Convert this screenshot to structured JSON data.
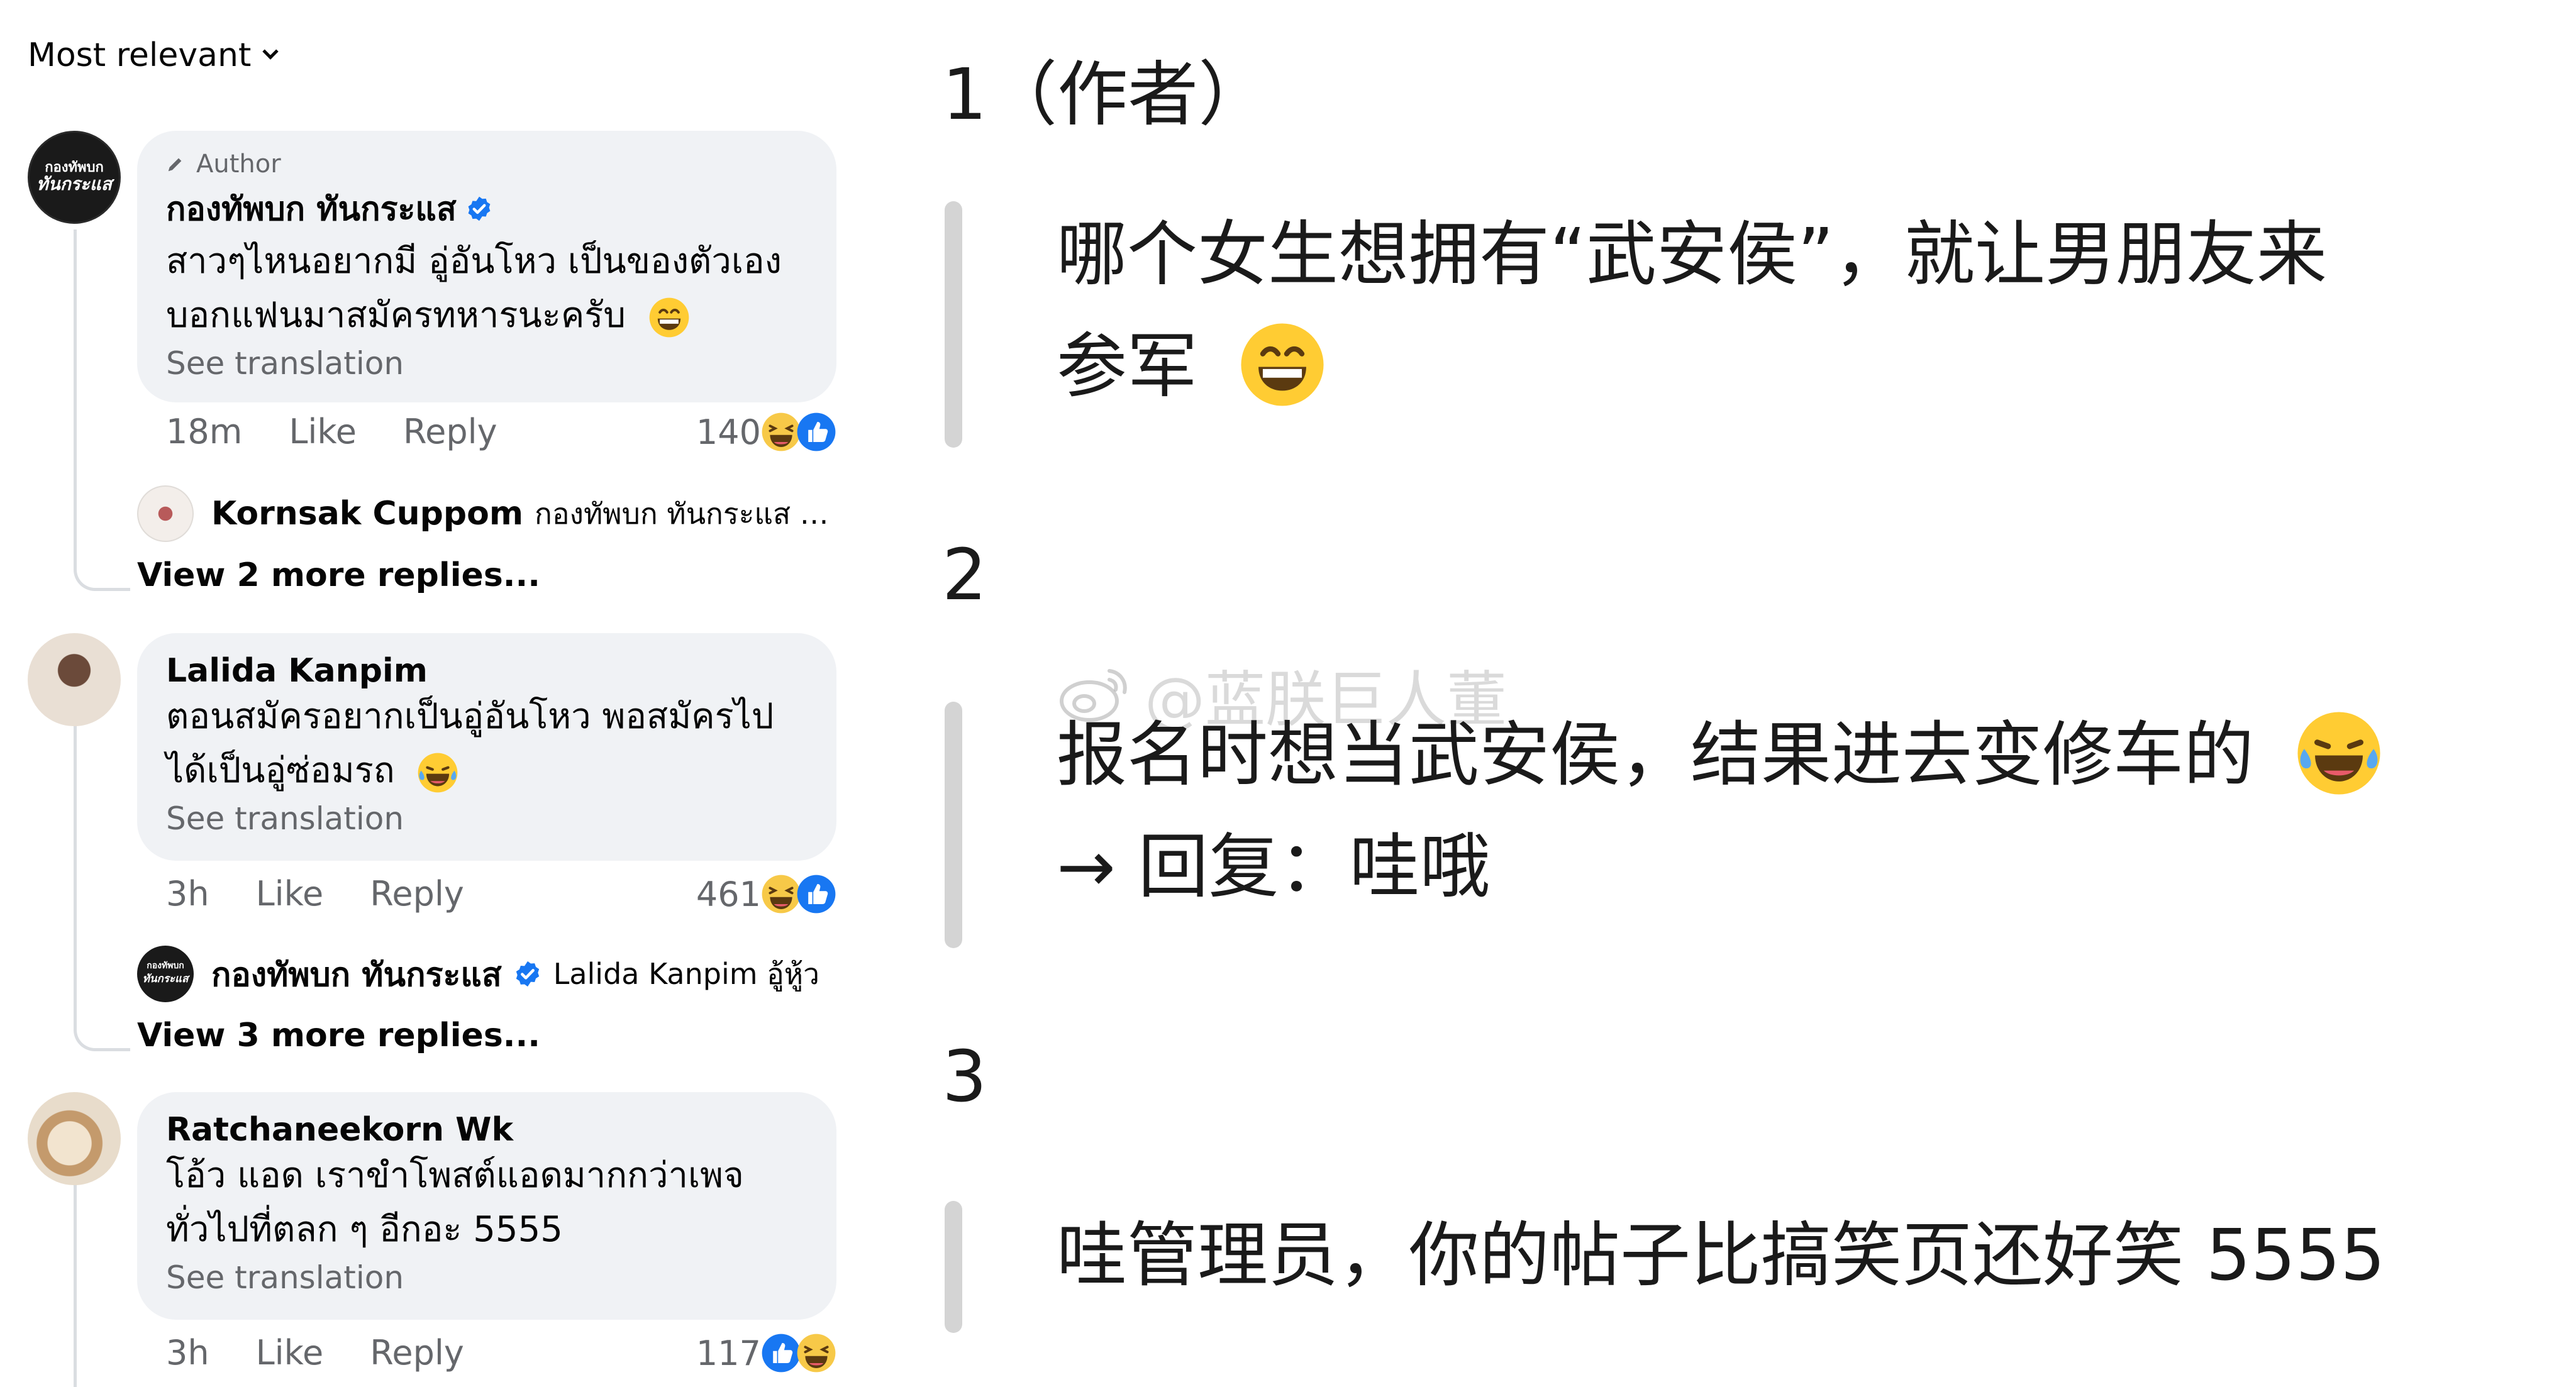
{
  "sort": {
    "label": "Most relevant"
  },
  "comments": [
    {
      "author_tag": "Author",
      "name": "กองทัพบก ทันกระแส",
      "avatar_text": [
        "กองทัพบก",
        "ทันกระแส"
      ],
      "text_lines": [
        "สาวๆไหนอยากมี อู่อันโหว เป็นของตัวเอง",
        "บอกแฟนมาสมัครทหารนะครับ"
      ],
      "see_translation": "See translation",
      "time": "18m",
      "like": "Like",
      "reply": "Reply",
      "reactions_count": "140",
      "reply_preview": {
        "name": "Kornsak Cuppom",
        "snippet": "กองทัพบก ทันกระแส แล้…"
      },
      "more_replies": "View 2 more replies..."
    },
    {
      "name": "Lalida Kanpim",
      "text_lines": [
        "ตอนสมัครอยากเป็นอู่อันโหว พอสมัครไป",
        "ได้เป็นอู่ซ่อมรถ"
      ],
      "see_translation": "See translation",
      "time": "3h",
      "like": "Like",
      "reply": "Reply",
      "reactions_count": "461",
      "reply_preview": {
        "name": "กองทัพบก ทันกระแส",
        "snippet": "Lalida Kanpim อู้หู้ว"
      },
      "more_replies": "View 3 more replies..."
    },
    {
      "name": "Ratchaneekorn Wk",
      "text_lines": [
        "โอ้ว แอด เราขำโพสต์แอดมากกว่าเพจ",
        "ทั่วไปที่ตลก ๆ อีกอะ 5555"
      ],
      "see_translation": "See translation",
      "time": "3h",
      "like": "Like",
      "reply": "Reply",
      "reactions_count": "117"
    }
  ],
  "annotations": [
    {
      "num": "1（作者）",
      "lines": [
        "哪个女生想拥有“武安侯”，就让男朋友来",
        "参军"
      ]
    },
    {
      "num": "2",
      "lines": [
        "报名时想当武安侯，结果进去变修车的",
        "→ 回复：哇哦"
      ]
    },
    {
      "num": "3",
      "lines": [
        "哇管理员，你的帖子比搞笑页还好笑 5555"
      ]
    }
  ],
  "watermark": "@蓝朕巨人董",
  "icons": {
    "verified": "verified-badge-icon",
    "haha": "haha-reaction-icon",
    "like": "like-reaction-icon",
    "grin": "grin-emoji",
    "tears": "tears-of-joy-emoji"
  },
  "colors": {
    "bubble": "#f0f2f5",
    "meta": "#65676b",
    "fb_blue": "#1877f2",
    "bar": "#d4d4d4"
  }
}
